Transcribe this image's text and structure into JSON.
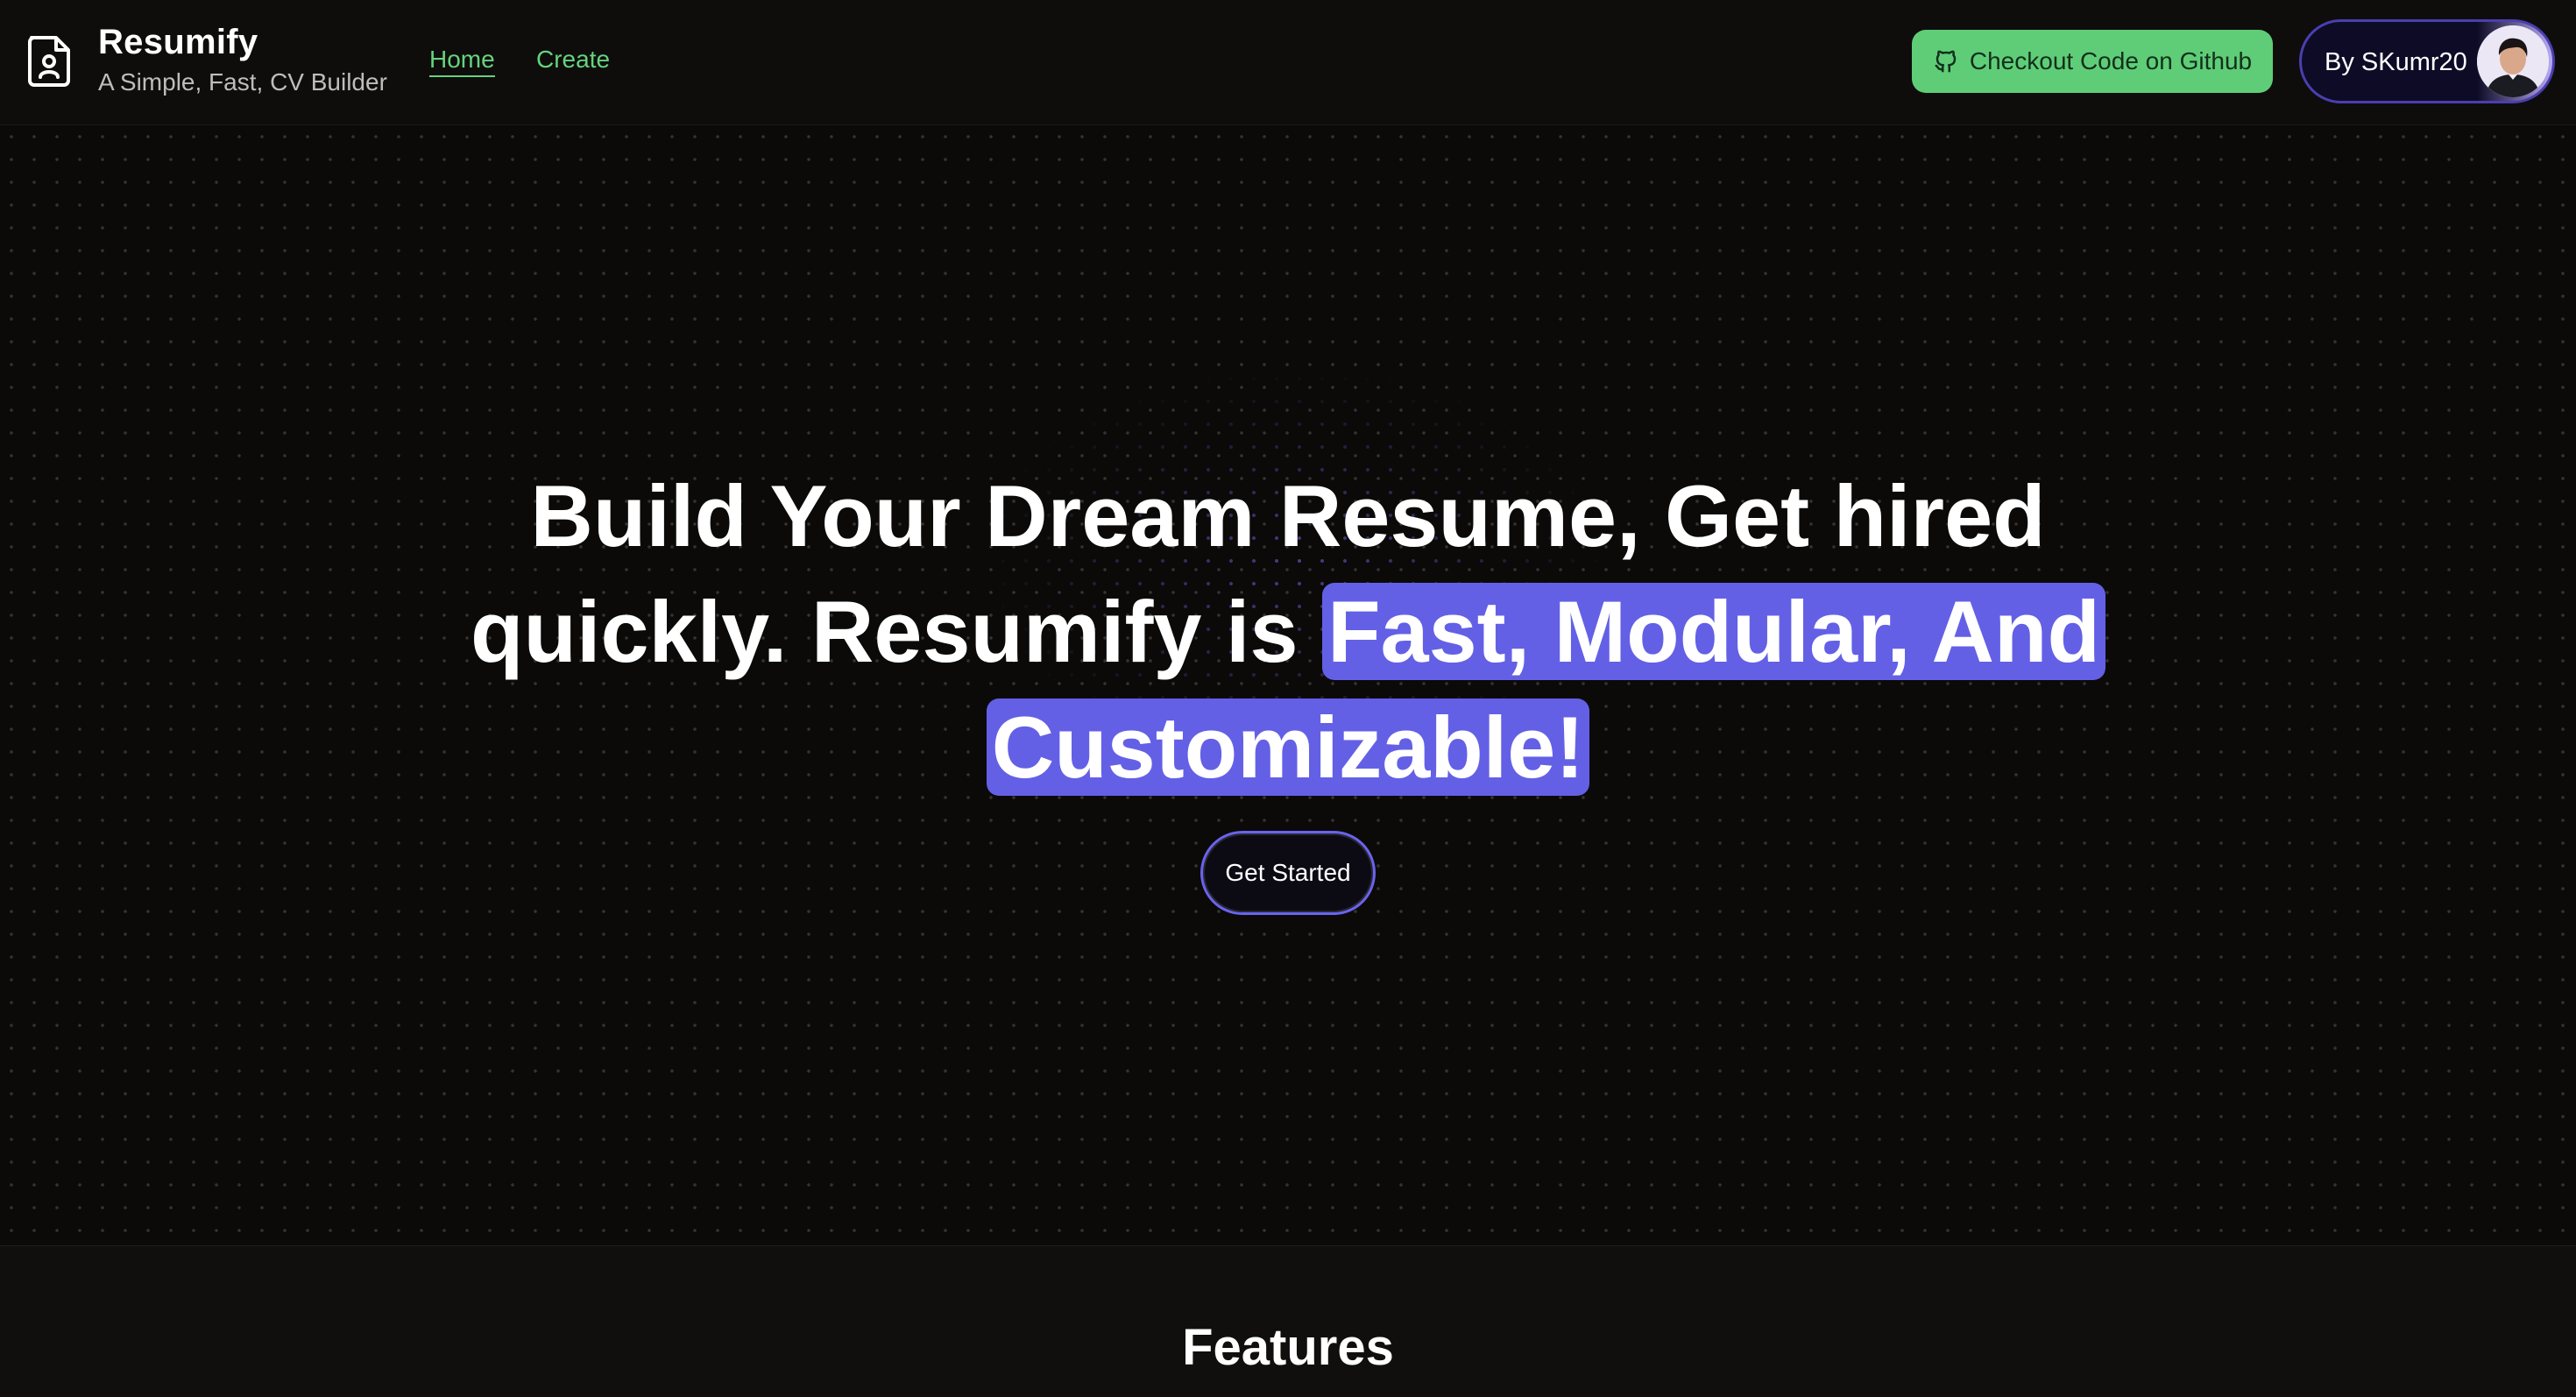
{
  "brand": {
    "title": "Resumify",
    "subtitle": "A Simple, Fast, CV Builder"
  },
  "nav": {
    "home": "Home",
    "create": "Create"
  },
  "header_actions": {
    "github_label": "Checkout Code on Github",
    "author_label": "By SKumr20"
  },
  "hero": {
    "heading_plain": "Build Your Dream Resume, Get hired quickly. Resumify is ",
    "heading_highlight": "Fast, Modular, And Customizable!",
    "cta_label": "Get Started"
  },
  "features": {
    "title": "Features"
  },
  "colors": {
    "accent_green": "#5fcd78",
    "highlight_purple": "#6360e6",
    "background": "#0b0a09"
  },
  "icons": {
    "brand": "resume-document-icon",
    "github": "github-icon",
    "avatar": "user-avatar"
  }
}
